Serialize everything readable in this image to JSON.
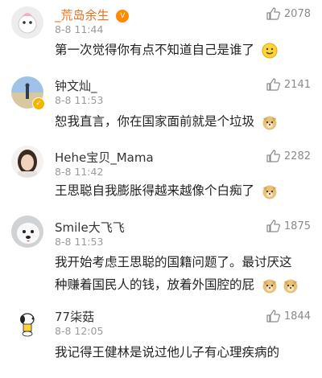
{
  "comments": [
    {
      "username": "_荒岛余生",
      "time": "8-8 11:44",
      "likes": "2078",
      "text": "第一次觉得你有点不知道自己是谁了",
      "badge": "vip",
      "avatar_icon": "cartoon-avatar-icon",
      "trailing_emoji": "smile-emoji-icon"
    },
    {
      "username": "钟文灿_",
      "time": "8-8 11:53",
      "likes": "2141",
      "text": "恕我直言，你在国家面前就是个垃圾",
      "badge": "verified",
      "avatar_icon": "beach-avatar-icon",
      "trailing_emoji": "doge-emoji-icon"
    },
    {
      "username": "Hehe宝贝_Mama",
      "time": "8-8 11:42",
      "likes": "2282",
      "text": "王思聪自我膨胀得越来越像个白痴了",
      "avatar_icon": "woman-avatar-icon",
      "trailing_emoji": "doge-emoji-icon"
    },
    {
      "username": "Smile大飞飞",
      "time": "8-8 11:53",
      "likes": "1875",
      "text_line1": "我开始考虑王思聪的国籍问题了。最讨厌这",
      "text_line2": "种赚着国民人的钱，放着外国腔的屁",
      "avatar_icon": "white-dog-avatar-icon",
      "trailing_emoji": "doge-emoji-icon"
    },
    {
      "username": "77柒菇",
      "time": "8-8 12:05",
      "likes": "1844",
      "text": "我记得王健林是说过他儿子有心理疾病的",
      "avatar_icon": "snoopy-avatar-icon"
    }
  ],
  "colors": {
    "username_orange": "#e8711c",
    "text": "#222222",
    "meta": "#9a9a9a"
  },
  "icons": {
    "like": "thumbs-up-icon"
  }
}
